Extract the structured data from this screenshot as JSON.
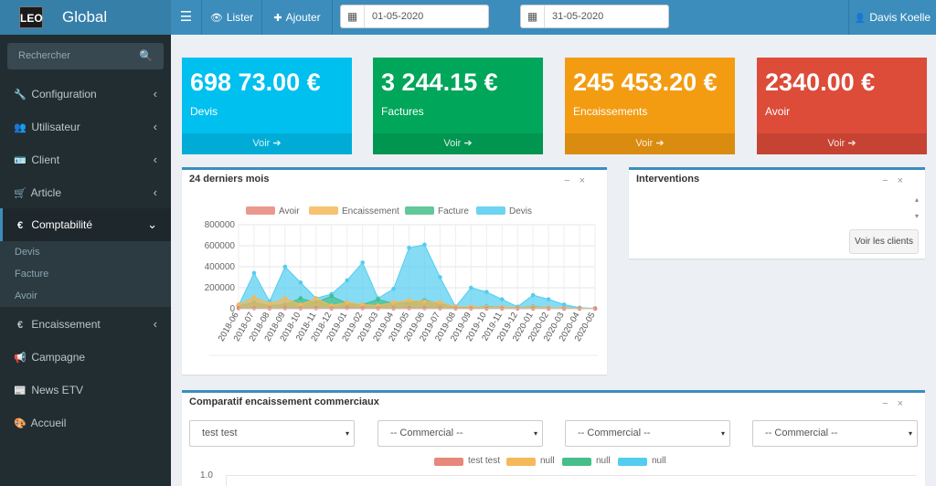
{
  "app": {
    "logo_mark": "LEO",
    "title": "Global"
  },
  "topbar": {
    "menu_icon": "☰",
    "list_icon": "👁",
    "list_label": "Lister",
    "add_icon": "✚",
    "add_label": "Ajouter",
    "date_icon": "▦",
    "date_from": "01-05-2020",
    "date_to": "31-05-2020",
    "user_icon": "👤",
    "user_name": "Davis Koelle"
  },
  "sidebar": {
    "search_placeholder": "Rechercher",
    "search_icon": "🔍",
    "items": [
      {
        "icon": "🔧",
        "label": "Configuration",
        "chevron": "‹"
      },
      {
        "icon": "👥",
        "label": "Utilisateur",
        "chevron": "‹"
      },
      {
        "icon": "🪪",
        "label": "Client",
        "chevron": "‹"
      },
      {
        "icon": "🛒",
        "label": "Article",
        "chevron": "‹"
      },
      {
        "icon": "€",
        "label": "Comptabilité",
        "chevron": "⌄"
      },
      {
        "icon": "€",
        "label": "Encaissement",
        "chevron": "‹"
      },
      {
        "icon": "📢",
        "label": "Campagne"
      },
      {
        "icon": "📰",
        "label": "News ETV"
      },
      {
        "icon": "🎨",
        "label": "Accueil"
      }
    ],
    "submenu": [
      "Devis",
      "Facture",
      "Avoir"
    ]
  },
  "tiles": [
    {
      "value": "698 73.00 €",
      "label": "Devis",
      "link": "Voir",
      "color": "#00c0ef"
    },
    {
      "value": "3 244.15 €",
      "label": "Factures",
      "link": "Voir",
      "color": "#00a65a"
    },
    {
      "value": "245 453.20 €",
      "label": "Encaissements",
      "link": "Voir",
      "color": "#f39c12"
    },
    {
      "value": "2340.00 €",
      "label": "Avoir",
      "link": "Voir",
      "color": "#dd4b39"
    }
  ],
  "tile_link_icon": "➔",
  "box_tools": {
    "minimize": "−",
    "close": "×"
  },
  "chart_box": {
    "title": "24 derniers mois"
  },
  "interventions": {
    "title": "Interventions",
    "button": "Voir les clients",
    "scroll_up": "▴",
    "scroll_down": "▾"
  },
  "comparatif": {
    "title": "Comparatif encaissement commerciaux",
    "selects": [
      "test test",
      "-- Commercial --",
      "-- Commercial --",
      "-- Commercial --"
    ],
    "caret": "▾",
    "legend": [
      {
        "name": "test test",
        "color": "#e8877b"
      },
      {
        "name": "null",
        "color": "#f5b85a"
      },
      {
        "name": "null",
        "color": "#46be8a"
      },
      {
        "name": "null",
        "color": "#52cdf0"
      }
    ],
    "ytick": "1.0"
  },
  "chart_data": {
    "type": "area",
    "categories": [
      "2018-06",
      "2018-07",
      "2018-08",
      "2018-09",
      "2018-10",
      "2018-11",
      "2018-12",
      "2019-01",
      "2019-02",
      "2019-03",
      "2019-04",
      "2019-05",
      "2019-06",
      "2019-07",
      "2019-08",
      "2019-09",
      "2019-10",
      "2019-11",
      "2019-12",
      "2020-01",
      "2020-02",
      "2020-03",
      "2020-04",
      "2020-05"
    ],
    "yticks": [
      "800000",
      "600000",
      "400000",
      "200000",
      "0"
    ],
    "ylim": [
      0,
      800000
    ],
    "series": [
      {
        "name": "Avoir",
        "color": "#e8877b",
        "values": [
          5000,
          5000,
          3000,
          5000,
          4000,
          5000,
          3000,
          8000,
          5000,
          4000,
          3000,
          5000,
          5000,
          4000,
          3000,
          3000,
          2000,
          2000,
          2000,
          2000,
          1000,
          1000,
          1000,
          1000
        ]
      },
      {
        "name": "Encaissement",
        "color": "#f5b85a",
        "values": [
          40000,
          110000,
          50000,
          100000,
          40000,
          100000,
          30000,
          60000,
          40000,
          30000,
          60000,
          80000,
          70000,
          60000,
          20000,
          20000,
          15000,
          15000,
          10000,
          15000,
          10000,
          8000,
          5000,
          3000
        ]
      },
      {
        "name": "Facture",
        "color": "#46be8a",
        "values": [
          30000,
          60000,
          30000,
          40000,
          100000,
          60000,
          120000,
          50000,
          40000,
          90000,
          50000,
          60000,
          80000,
          50000,
          20000,
          15000,
          20000,
          15000,
          10000,
          20000,
          10000,
          8000,
          5000,
          2000
        ]
      },
      {
        "name": "Devis",
        "color": "#52cdf0",
        "values": [
          30000,
          340000,
          70000,
          400000,
          250000,
          100000,
          140000,
          270000,
          440000,
          100000,
          190000,
          580000,
          610000,
          300000,
          20000,
          200000,
          160000,
          90000,
          20000,
          130000,
          90000,
          40000,
          10000,
          5000
        ]
      }
    ]
  }
}
